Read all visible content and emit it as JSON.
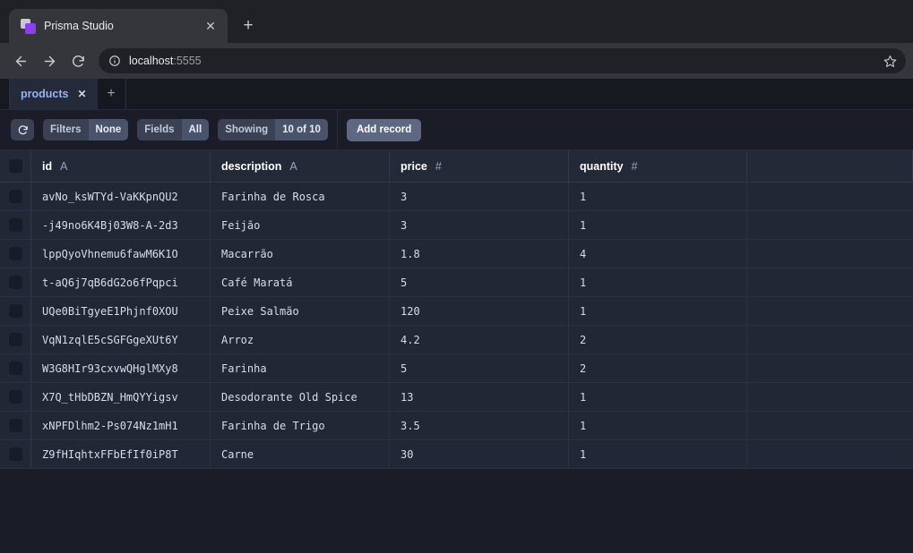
{
  "browser": {
    "tab_title": "Prisma Studio",
    "favicon": "prisma-logo-icon",
    "close_label": "✕",
    "new_tab_label": "+",
    "back_label": "←",
    "forward_label": "→",
    "reload_label": "↻",
    "info_label": "ⓘ",
    "url_host": "localhost",
    "url_port": ":5555",
    "bookmark_label": "☆"
  },
  "studio": {
    "tabs": [
      {
        "label": "products",
        "close": "✕",
        "active": true
      }
    ],
    "add_tab_label": "+",
    "toolbar": {
      "refresh_label": "↻",
      "filters_key": "Filters",
      "filters_value": "None",
      "fields_key": "Fields",
      "fields_value": "All",
      "showing_key": "Showing",
      "showing_value": "10 of 10",
      "add_record_label": "Add record"
    },
    "table": {
      "columns": [
        {
          "name": "id",
          "type_glyph": "A"
        },
        {
          "name": "description",
          "type_glyph": "A"
        },
        {
          "name": "price",
          "type_glyph": "#"
        },
        {
          "name": "quantity",
          "type_glyph": "#"
        }
      ],
      "rows": [
        {
          "id": "avNo_ksWTYd-VaKKpnQU2",
          "description": "Farinha de Rosca",
          "price": "3",
          "quantity": "1"
        },
        {
          "id": "-j49no6K4Bj03W8-A-2d3",
          "description": "Feijão",
          "price": "3",
          "quantity": "1"
        },
        {
          "id": "lppQyoVhnemu6fawM6K1O",
          "description": "Macarrão",
          "price": "1.8",
          "quantity": "4"
        },
        {
          "id": "t-aQ6j7qB6dG2o6fPqpci",
          "description": "Café Maratá",
          "price": "5",
          "quantity": "1"
        },
        {
          "id": "UQe0BiTgyeE1Phjnf0XOU",
          "description": "Peixe Salmão",
          "price": "120",
          "quantity": "1"
        },
        {
          "id": "VqN1zqlE5cSGFGgeXUt6Y",
          "description": "Arroz",
          "price": "4.2",
          "quantity": "2"
        },
        {
          "id": "W3G8HIr93cxvwQHglMXy8",
          "description": "Farinha",
          "price": "5",
          "quantity": "2"
        },
        {
          "id": "X7Q_tHbDBZN_HmQYYigsv",
          "description": "Desodorante Old Spice",
          "price": "13",
          "quantity": "1"
        },
        {
          "id": "xNPFDlhm2-Ps074Nz1mH1",
          "description": "Farinha de Trigo",
          "price": "3.5",
          "quantity": "1"
        },
        {
          "id": "Z9fHIqhtxFFbEfIf0iP8T",
          "description": "Carne",
          "price": "30",
          "quantity": "1"
        }
      ]
    }
  },
  "colors": {
    "browser_chrome": "#35363a",
    "browser_bg": "#202124",
    "page_bg": "#1a1d27",
    "header_bg": "#242938",
    "row_bg": "#222736",
    "tab_accent": "#93b4ef",
    "button_primary": "#5d6882",
    "prisma_purple": "#8b3ff0"
  }
}
